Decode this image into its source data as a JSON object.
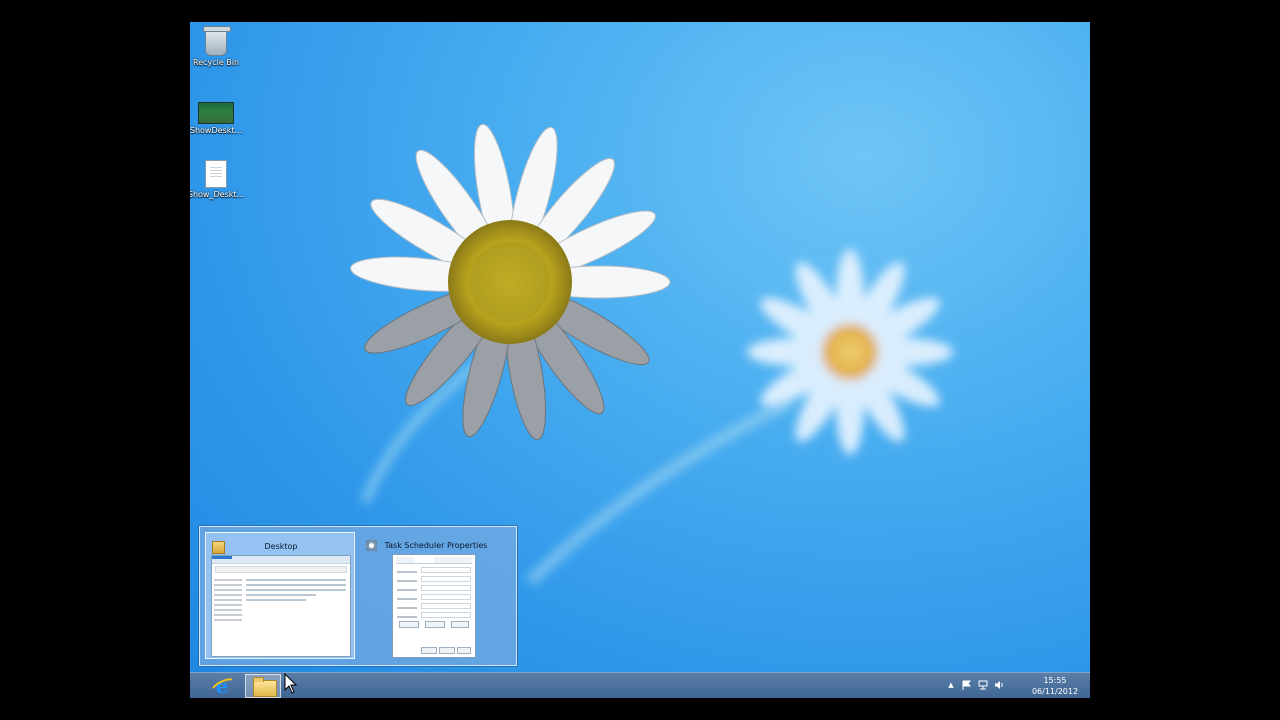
{
  "desktop": {
    "icons": [
      {
        "label": "Recycle Bin",
        "icon": "recycle-bin-icon"
      },
      {
        "label": "ShowDeskt...",
        "icon": "video-file-icon"
      },
      {
        "label": "Show_Deskt...",
        "icon": "text-document-icon"
      }
    ]
  },
  "thumbnails": {
    "items": [
      {
        "title": "Desktop",
        "icon": "folder-icon",
        "active": true
      },
      {
        "title": "Task Scheduler Properties",
        "icon": "task-scheduler-icon",
        "active": false
      }
    ]
  },
  "taskbar": {
    "pinned": [
      {
        "name": "Internet Explorer",
        "icon": "internet-explorer-icon"
      },
      {
        "name": "File Explorer",
        "icon": "folder-icon"
      }
    ],
    "tray": {
      "show_hidden": "▲",
      "icons": [
        "action-center-flag-icon",
        "network-icon",
        "volume-icon"
      ]
    },
    "clock": {
      "time": "15:55",
      "date": "06/11/2012"
    }
  },
  "colors": {
    "wallpaper_sky": "#2f97ea",
    "taskbar": "#4a6f9c",
    "thumbnail_panel": "#78aae1"
  }
}
